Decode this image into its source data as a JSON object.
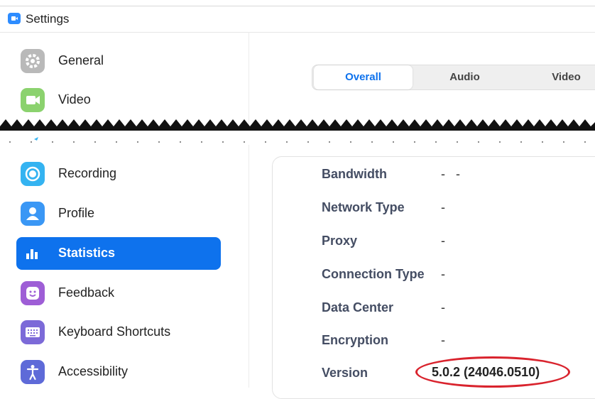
{
  "window": {
    "title": "Settings"
  },
  "sidebar": {
    "items": [
      {
        "label": "General",
        "icon": "gear-icon",
        "color": "#b9b9b9"
      },
      {
        "label": "Video",
        "icon": "video-camera-icon",
        "color": "#8bd26e"
      },
      {
        "label": "Recording",
        "icon": "record-icon",
        "color": "#34b3f1"
      },
      {
        "label": "Profile",
        "icon": "user-icon",
        "color": "#3a97f5"
      },
      {
        "label": "Statistics",
        "icon": "bar-chart-icon",
        "color": "#0e72ed",
        "selected": true
      },
      {
        "label": "Feedback",
        "icon": "smiley-icon",
        "color": "#9e5ed6"
      },
      {
        "label": "Keyboard Shortcuts",
        "icon": "keyboard-icon",
        "color": "#7c6ad8"
      },
      {
        "label": "Accessibility",
        "icon": "accessibility-icon",
        "color": "#5e6ad8"
      }
    ]
  },
  "tabs": [
    {
      "label": "Overall",
      "active": true
    },
    {
      "label": "Audio",
      "active": false
    },
    {
      "label": "Video",
      "active": false
    }
  ],
  "stats": {
    "bandwidth": {
      "label": "Bandwidth",
      "value": "-   -"
    },
    "network_type": {
      "label": "Network Type",
      "value": "-"
    },
    "proxy": {
      "label": "Proxy",
      "value": "-"
    },
    "connection_type": {
      "label": "Connection Type",
      "value": "-"
    },
    "data_center": {
      "label": "Data Center",
      "value": "-"
    },
    "encryption": {
      "label": "Encryption",
      "value": "-"
    },
    "version": {
      "label": "Version",
      "value": "5.0.2 (24046.0510)"
    }
  },
  "colors": {
    "accent": "#0e72ed",
    "highlight": "#d9232d"
  }
}
